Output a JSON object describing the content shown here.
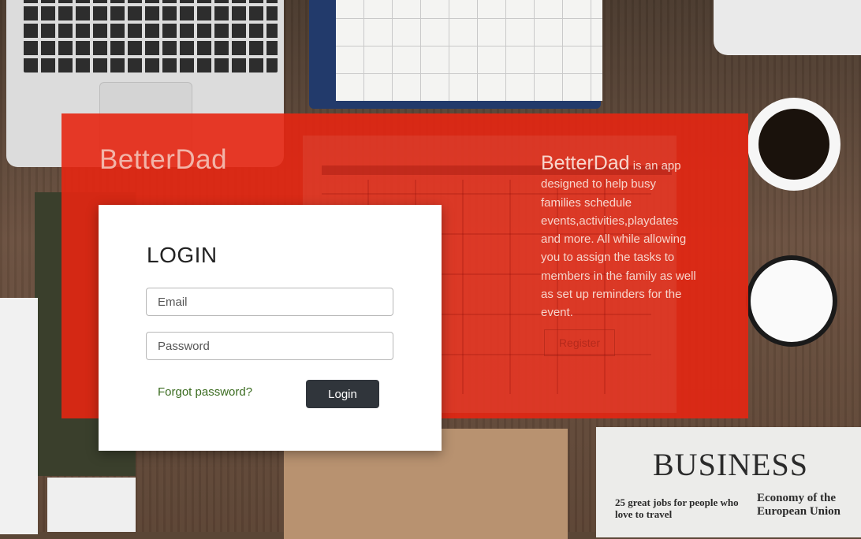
{
  "brand": {
    "name": "BetterDad"
  },
  "login": {
    "title": "LOGIN",
    "email_placeholder": "Email",
    "password_placeholder": "Password",
    "forgot_label": "Forgot password?",
    "login_label": "Login"
  },
  "about": {
    "brand": "BetterDad",
    "text": " is an app designed to help busy families schedule events,activities,playdates and more. All while allowing you to assign the tasks to members in the family as well as set up reminders for the event.",
    "register_label": "Register"
  },
  "background": {
    "newspaper_title": "BUSINESS",
    "newspaper_headline_1": "25 great jobs for people who love to travel",
    "newspaper_headline_2": "Economy of the European Union"
  },
  "colors": {
    "hero": "#e62612",
    "login_button": "#30353b",
    "forgot_link": "#3a6b1f"
  }
}
